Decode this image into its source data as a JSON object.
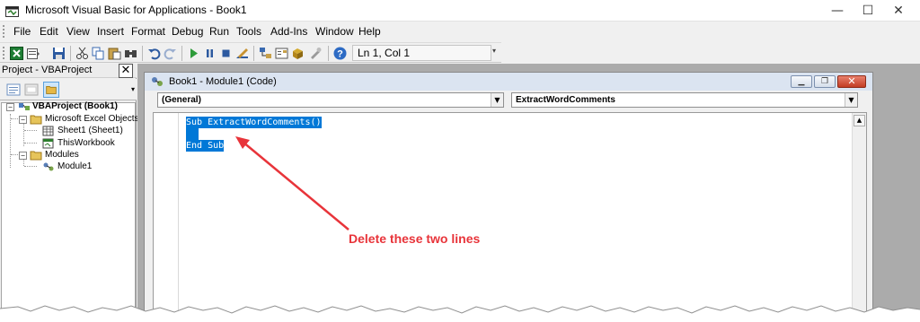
{
  "window": {
    "title": "Microsoft Visual Basic for Applications - Book1",
    "controls": {
      "minimize": "—",
      "maximize": "☐",
      "close": "✕"
    }
  },
  "menu": [
    "File",
    "Edit",
    "View",
    "Insert",
    "Format",
    "Debug",
    "Run",
    "Tools",
    "Add-Ins",
    "Window",
    "Help"
  ],
  "toolbar": {
    "status": "Ln 1, Col 1",
    "icons": [
      "excel-icon",
      "insert-module-icon",
      "save-icon",
      "cut-icon",
      "copy-icon",
      "paste-icon",
      "find-icon",
      "undo-icon",
      "redo-icon",
      "run-icon",
      "break-icon",
      "reset-icon",
      "design-mode-icon",
      "project-explorer-icon",
      "properties-icon",
      "object-browser-icon",
      "toolbox-icon",
      "help-icon"
    ]
  },
  "project_pane": {
    "title": "Project - VBAProject",
    "close": "✕",
    "tree": {
      "root": "VBAProject (Book1)",
      "objects_folder": "Microsoft Excel Objects",
      "sheet1": "Sheet1 (Sheet1)",
      "workbook": "ThisWorkbook",
      "modules_folder": "Modules",
      "module1": "Module1"
    }
  },
  "code_window": {
    "title": "Book1 - Module1 (Code)",
    "object_combo": "(General)",
    "procedure_combo": "ExtractWordComments",
    "lines": [
      "Sub ExtractWordComments()",
      "    ",
      "End Sub"
    ]
  },
  "annotation": {
    "text": "Delete these two lines",
    "color": "#e8343a"
  },
  "colors": {
    "selection": "#0078d7",
    "mdi_background": "#ababab",
    "code_title_bar": "#dbe4f1"
  }
}
